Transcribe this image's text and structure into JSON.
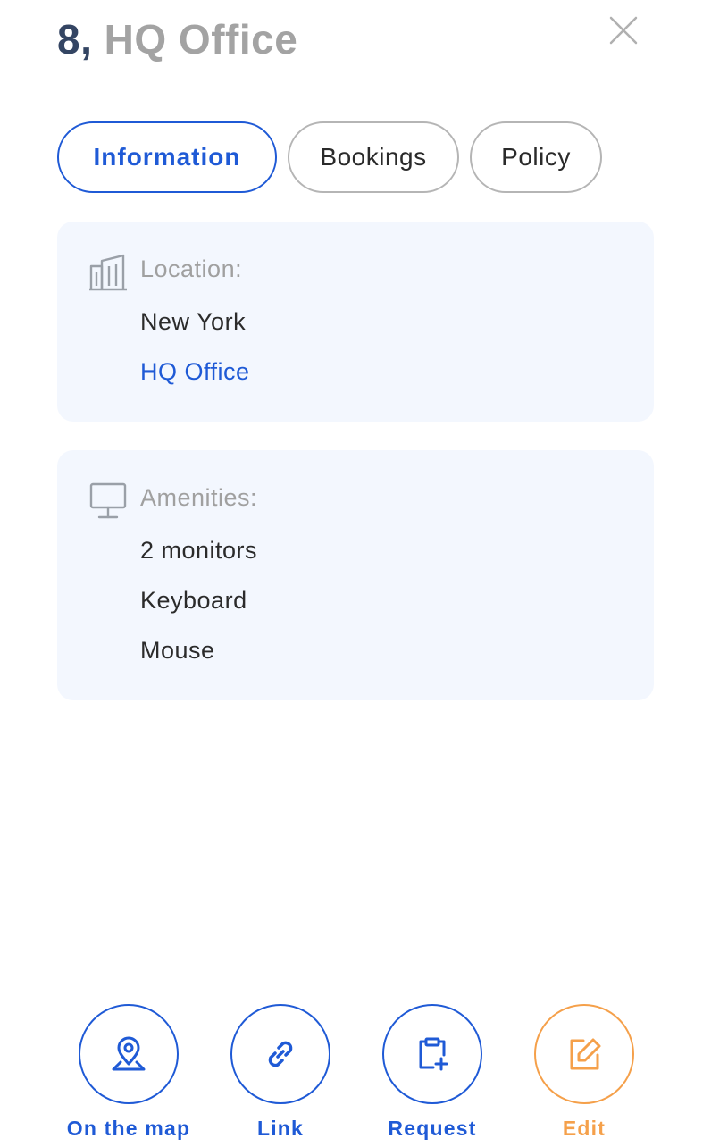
{
  "header": {
    "seat_number": "8,",
    "location_name": "HQ Office",
    "close_icon": "close-icon"
  },
  "tabs": [
    {
      "label": "Information",
      "active": true
    },
    {
      "label": "Bookings",
      "active": false
    },
    {
      "label": "Policy",
      "active": false
    }
  ],
  "location_card": {
    "icon": "building-icon",
    "label": "Location:",
    "city": "New York",
    "office_link": "HQ Office"
  },
  "amenities_card": {
    "icon": "monitor-icon",
    "label": "Amenities:",
    "items": [
      "2 monitors",
      "Keyboard",
      "Mouse"
    ]
  },
  "actions": [
    {
      "label": "On the map",
      "icon": "map-pin-icon",
      "color": "#1f5ad6"
    },
    {
      "label": "Link",
      "icon": "link-icon",
      "color": "#1f5ad6"
    },
    {
      "label": "Request",
      "icon": "clipboard-plus-icon",
      "color": "#1f5ad6"
    },
    {
      "label": "Edit",
      "icon": "edit-icon",
      "color": "#f5a04a"
    }
  ],
  "colors": {
    "accent": "#1f5ad6",
    "edit": "#f5a04a",
    "card_bg": "#f3f7fe",
    "title_dark": "#344563",
    "muted": "#a0a0a0"
  }
}
